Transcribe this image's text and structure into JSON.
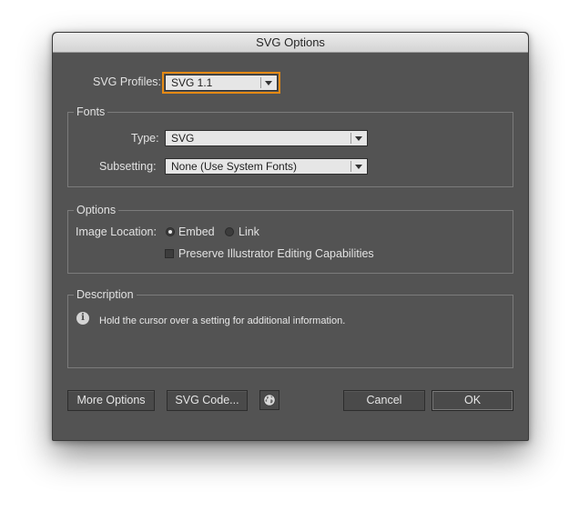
{
  "window": {
    "title": "SVG Options"
  },
  "profile": {
    "label": "SVG Profiles:",
    "value": "SVG 1.1"
  },
  "fonts": {
    "group_label": "Fonts",
    "type_label": "Type:",
    "type_value": "SVG",
    "subsetting_label": "Subsetting:",
    "subsetting_value": "None (Use System Fonts)"
  },
  "options": {
    "group_label": "Options",
    "image_location_label": "Image Location:",
    "embed_label": "Embed",
    "embed_selected": true,
    "link_label": "Link",
    "link_selected": false,
    "preserve_label": "Preserve Illustrator Editing Capabilities",
    "preserve_checked": false
  },
  "description": {
    "group_label": "Description",
    "icon": "info-icon",
    "text": "Hold the cursor over a setting for additional information."
  },
  "buttons": {
    "more_options": "More Options",
    "svg_code": "SVG Code...",
    "web_icon": "globe-icon",
    "cancel": "Cancel",
    "ok": "OK"
  },
  "colors": {
    "dialog_bg": "#535353",
    "focus_ring": "#e58a14",
    "text": "#e2e2e2"
  }
}
